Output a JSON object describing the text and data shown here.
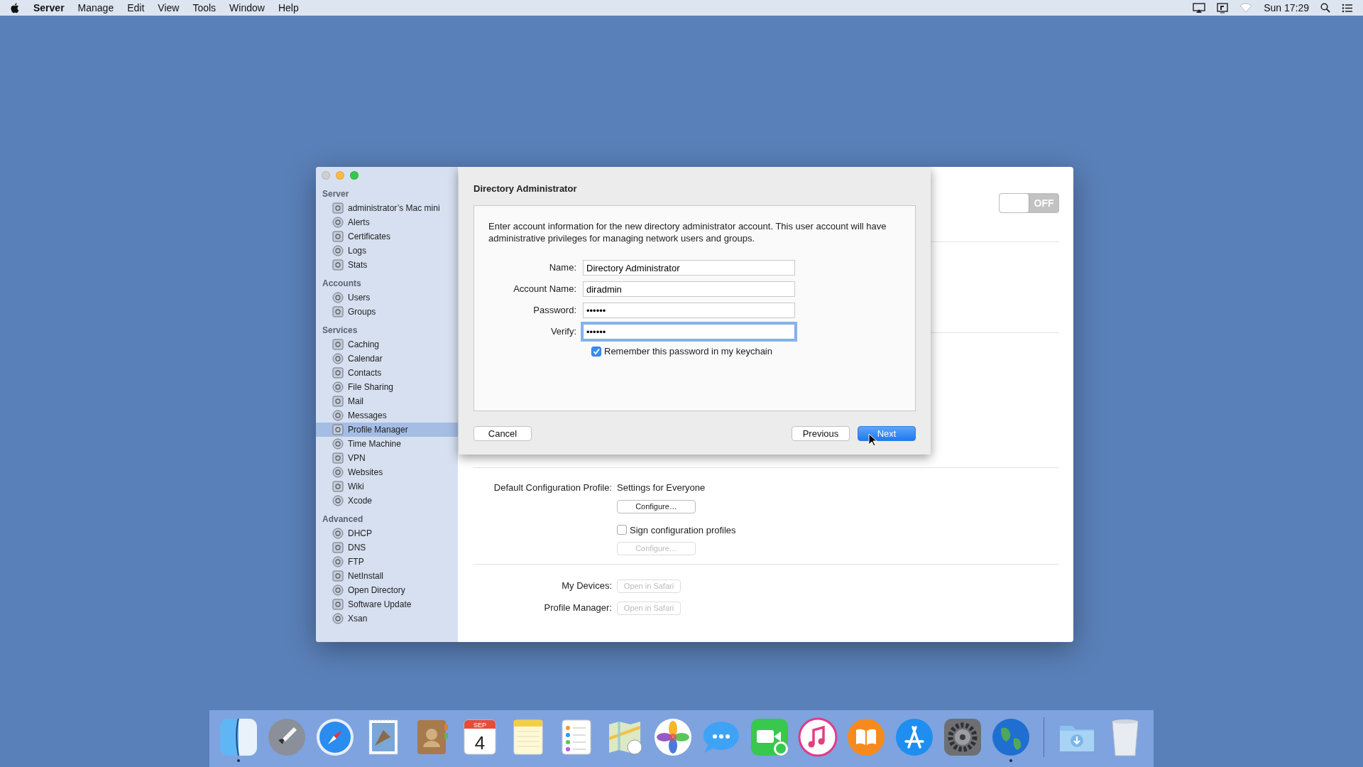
{
  "menu_bar": {
    "app": "Server",
    "menus": [
      "Manage",
      "Edit",
      "View",
      "Tools",
      "Window",
      "Help"
    ],
    "clock": "Sun 17:29"
  },
  "sidebar": {
    "sections": [
      {
        "title": "Server",
        "items": [
          {
            "label": "administrator’s Mac mini",
            "selected": false
          },
          {
            "label": "Alerts",
            "selected": false
          },
          {
            "label": "Certificates",
            "selected": false
          },
          {
            "label": "Logs",
            "selected": false
          },
          {
            "label": "Stats",
            "selected": false
          }
        ]
      },
      {
        "title": "Accounts",
        "items": [
          {
            "label": "Users",
            "selected": false
          },
          {
            "label": "Groups",
            "selected": false
          }
        ]
      },
      {
        "title": "Services",
        "items": [
          {
            "label": "Caching",
            "selected": false
          },
          {
            "label": "Calendar",
            "selected": false
          },
          {
            "label": "Contacts",
            "selected": false
          },
          {
            "label": "File Sharing",
            "selected": false
          },
          {
            "label": "Mail",
            "selected": false
          },
          {
            "label": "Messages",
            "selected": false
          },
          {
            "label": "Profile Manager",
            "selected": true
          },
          {
            "label": "Time Machine",
            "selected": false
          },
          {
            "label": "VPN",
            "selected": false
          },
          {
            "label": "Websites",
            "selected": false
          },
          {
            "label": "Wiki",
            "selected": false
          },
          {
            "label": "Xcode",
            "selected": false
          }
        ]
      },
      {
        "title": "Advanced",
        "items": [
          {
            "label": "DHCP",
            "selected": false
          },
          {
            "label": "DNS",
            "selected": false
          },
          {
            "label": "FTP",
            "selected": false
          },
          {
            "label": "NetInstall",
            "selected": false
          },
          {
            "label": "Open Directory",
            "selected": false
          },
          {
            "label": "Software Update",
            "selected": false
          },
          {
            "label": "Xsan",
            "selected": false
          }
        ]
      }
    ]
  },
  "service_toggle": {
    "label": "OFF",
    "on": false
  },
  "dialog": {
    "title": "Directory Administrator",
    "description": "Enter account information for the new directory administrator account. This user account will have administrative privileges for managing network users and groups.",
    "fields": [
      {
        "label": "Name:",
        "value": "Directory Administrator",
        "focused": false
      },
      {
        "label": "Account Name:",
        "value": "diradmin",
        "focused": false
      },
      {
        "label": "Password:",
        "value": "••••••",
        "focused": false
      },
      {
        "label": "Verify:",
        "value": "••••••",
        "focused": true
      }
    ],
    "remember": {
      "label": "Remember this password in my keychain",
      "checked": true
    },
    "buttons": [
      {
        "label": "Cancel",
        "kind": "default"
      },
      {
        "label": "Previous",
        "kind": "default"
      },
      {
        "label": "Next",
        "kind": "primary"
      }
    ]
  },
  "profile_settings": {
    "default_profile": {
      "label": "Default Configuration Profile:",
      "value": "Settings for Everyone",
      "button": {
        "label": "Configure…",
        "disabled": false
      }
    },
    "sign": {
      "label": "Sign configuration profiles",
      "checked": false,
      "button": {
        "label": "Configure…",
        "disabled": true
      }
    },
    "links": [
      {
        "label": "My Devices:",
        "button": {
          "label": "Open in Safari",
          "disabled": true
        }
      },
      {
        "label": "Profile Manager:",
        "button": {
          "label": "Open in Safari",
          "disabled": true
        }
      }
    ]
  },
  "dock": {
    "apps": [
      {
        "running": true
      },
      {
        "running": false
      },
      {
        "running": false
      },
      {
        "running": false
      },
      {
        "running": false
      },
      {
        "running": false,
        "month": "SEP",
        "day": "4"
      },
      {
        "running": false
      },
      {
        "running": false
      },
      {
        "running": false
      },
      {
        "running": false
      },
      {
        "running": false
      },
      {
        "running": false
      },
      {
        "running": false
      },
      {
        "running": false
      },
      {
        "running": false
      },
      {
        "running": false
      },
      {
        "running": true
      }
    ]
  }
}
